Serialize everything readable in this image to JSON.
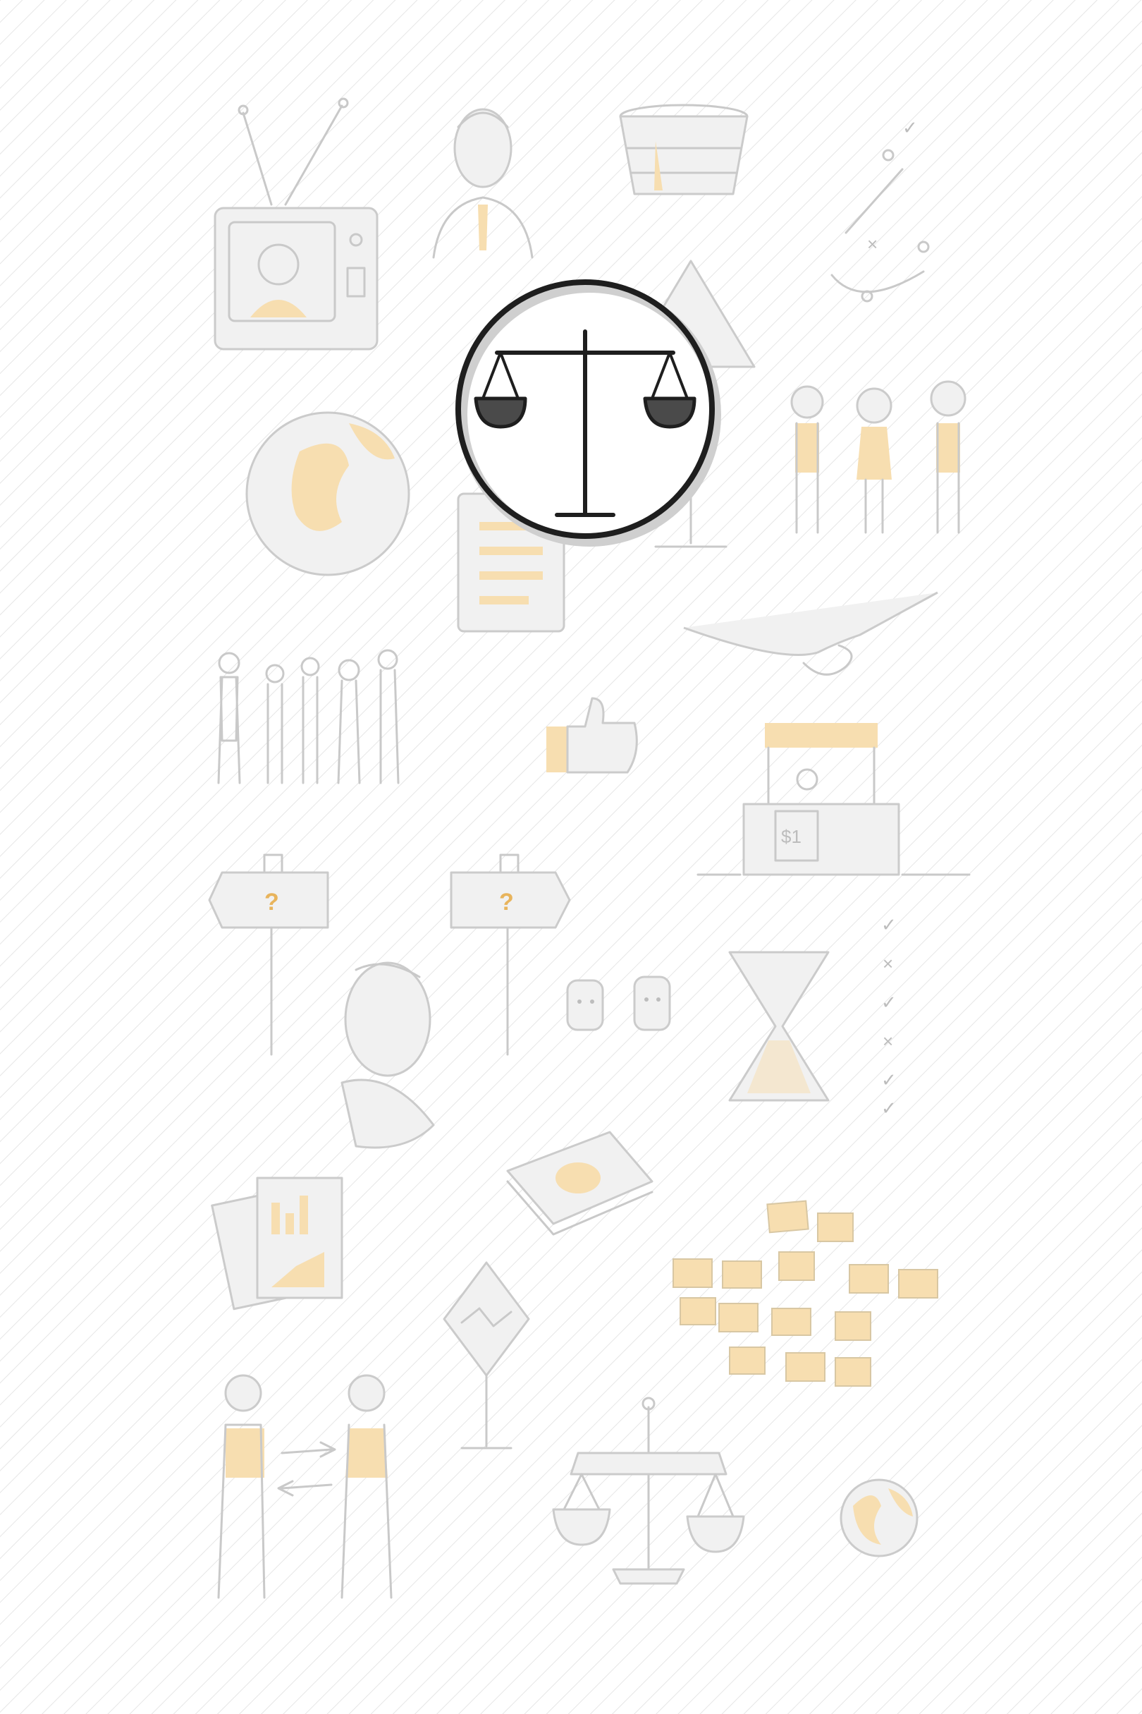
{
  "background": {
    "color": "#ffffff",
    "hatch_color": "#e4e4e4"
  },
  "palette": {
    "sketch_gray": "#c9c9c9",
    "accent_yellow": "#f7deb0",
    "focus_ink": "#1e1e1e"
  },
  "focus": {
    "icon": "balance-scale-icon",
    "ring_color": "#1e1e1e"
  },
  "signposts": {
    "left_mark": "?",
    "right_mark": "?"
  },
  "market_stall": {
    "sign": "$1"
  },
  "illustrations": [
    "television-icon",
    "businessman-icon",
    "basket-icon",
    "strategy-play-icon",
    "warning-sign-icon",
    "globe-icon",
    "clipboard-icon",
    "three-people-icon",
    "handshake-icon",
    "crowd-icon",
    "thumbs-up-icon",
    "market-stall-icon",
    "signpost-icon",
    "thinking-person-icon",
    "two-faces-icon",
    "hourglass-icon",
    "checklist-icon",
    "money-stack-icon",
    "charts-icon",
    "road-sign-icon",
    "sticky-notes-icon",
    "exchange-people-icon",
    "scale-icon",
    "small-globe-icon"
  ]
}
